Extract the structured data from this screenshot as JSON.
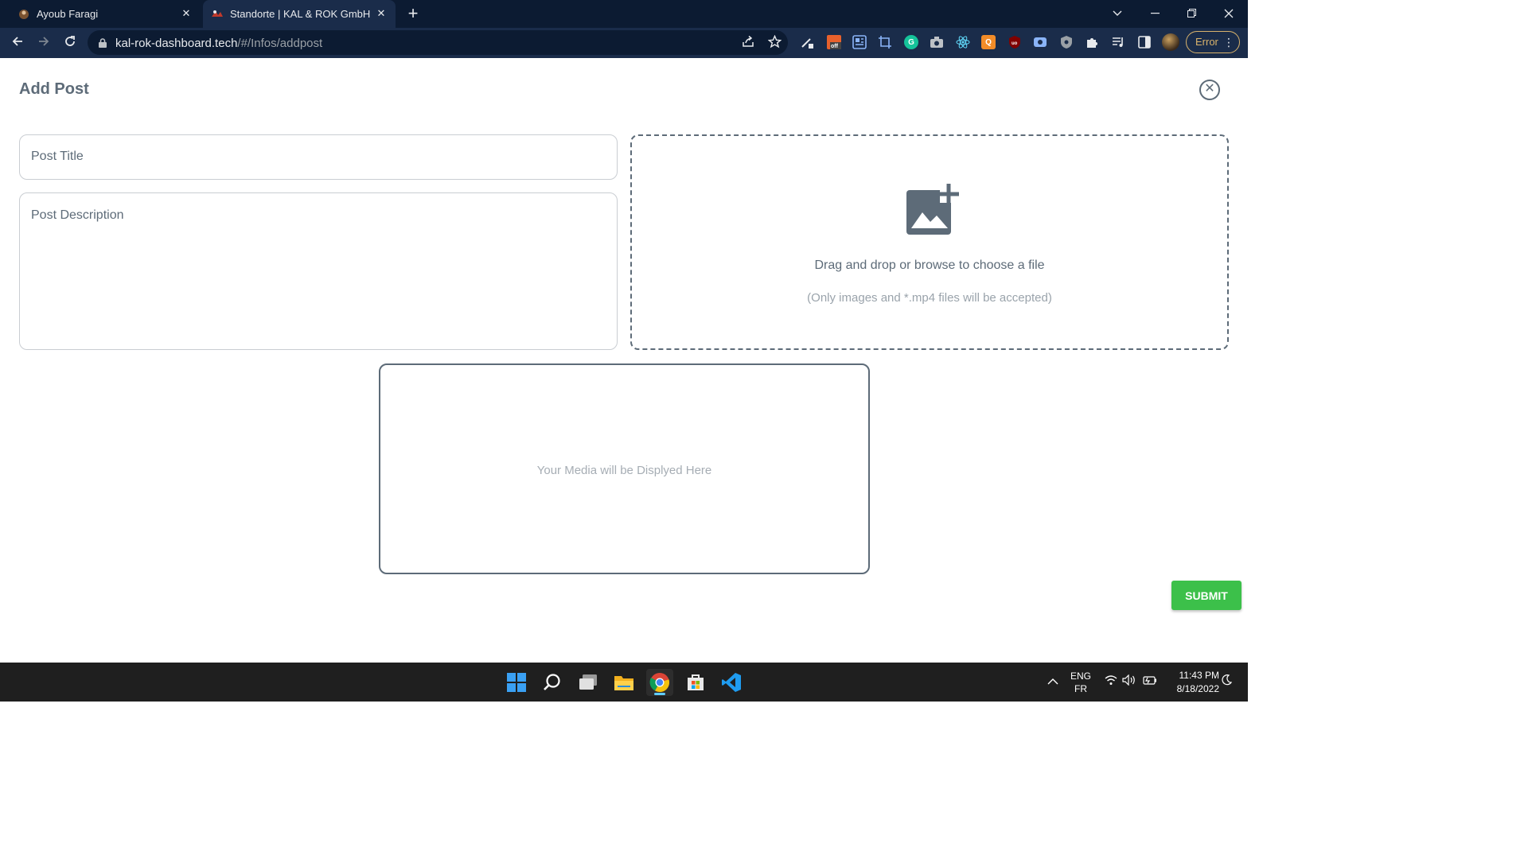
{
  "browser": {
    "tabs": [
      {
        "title": "Ayoub Faragi",
        "active": false
      },
      {
        "title": "Standorte | KAL & ROK GmbH",
        "active": true
      }
    ],
    "url_host": "kal-rok-dashboard.tech",
    "url_path": "/#/Infos/addpost",
    "profile_button_label": "Error",
    "accent_color": "#d9b36c",
    "extensions": [
      "pen-tool-icon",
      "off-badge-icon",
      "translate-icon",
      "screenshot-crop-icon",
      "grammarly-icon",
      "camera-icon",
      "react-devtools-icon",
      "orange-q-icon",
      "ublock-icon",
      "screen-recorder-icon",
      "shield-icon",
      "puzzle-icon",
      "media-queue-icon",
      "side-panel-icon"
    ]
  },
  "page": {
    "title": "Add Post",
    "title_input_placeholder": "Post Title",
    "description_placeholder": "Post Description",
    "dropzone": {
      "message": "Drag and drop or browse to choose a file",
      "hint": "(Only images and *.mp4 files will be accepted)"
    },
    "preview_placeholder": "Your Media will be Displyed Here",
    "submit_label": "SUBMIT",
    "submit_color": "#3cc04a",
    "text_color": "#5d6b78"
  },
  "taskbar": {
    "apps": [
      "windows-start-icon",
      "search-icon",
      "task-view-icon",
      "file-explorer-icon",
      "chrome-icon",
      "microsoft-store-icon",
      "vscode-icon"
    ],
    "language_primary": "ENG",
    "language_secondary": "FR",
    "time": "11:43 PM",
    "date": "8/18/2022"
  }
}
